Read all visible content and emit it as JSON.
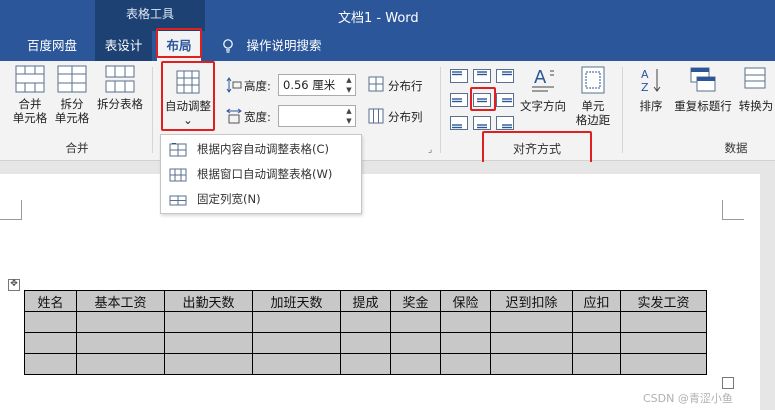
{
  "titlebar": {
    "context_group": "表格工具",
    "title": "文档1 - Word"
  },
  "tabs": [
    {
      "label": "百度网盘"
    },
    {
      "label": "表设计"
    },
    {
      "label": "布局"
    },
    {
      "label": "操作说明搜索"
    }
  ],
  "ribbon": {
    "merge_group": {
      "label": "合并",
      "buttons": [
        "合并\n单元格",
        "拆分\n单元格",
        "拆分表格"
      ]
    },
    "autofit": {
      "label": "自动调整",
      "arrow": "⌄"
    },
    "height": {
      "label": "高度:",
      "value": "0.56 厘米"
    },
    "width": {
      "label": "宽度:",
      "value": ""
    },
    "distribute_rows": "分布行",
    "distribute_cols": "分布列",
    "alignment_group": {
      "label": "对齐方式",
      "text_direction": "文字方向",
      "cell_margins": "单元\n格边距"
    },
    "data_group": {
      "label": "数据",
      "sort": "排序",
      "repeat_header": "重复标题行",
      "convert": "转换为"
    }
  },
  "autofit_menu": [
    {
      "label": "根据内容自动调整表格(C)",
      "icon": "autofit-content-icon"
    },
    {
      "label": "根据窗口自动调整表格(W)",
      "icon": "autofit-window-icon"
    },
    {
      "label": "固定列宽(N)",
      "icon": "fixed-width-icon"
    }
  ],
  "table": {
    "headers": [
      "姓名",
      "基本工资",
      "出勤天数",
      "加班天数",
      "提成",
      "奖金",
      "保险",
      "迟到扣除",
      "应扣",
      "实发工资"
    ],
    "rows": [
      [
        "",
        "",
        "",
        "",
        "",
        "",
        "",
        "",
        "",
        ""
      ],
      [
        "",
        "",
        "",
        "",
        "",
        "",
        "",
        "",
        "",
        ""
      ],
      [
        "",
        "",
        "",
        "",
        "",
        "",
        "",
        "",
        "",
        ""
      ]
    ]
  },
  "watermark": "CSDN @青涩小鱼",
  "colors": {
    "accent": "#2b579a",
    "highlight": "#e02020",
    "selected_cells": "#c8c8c8"
  }
}
